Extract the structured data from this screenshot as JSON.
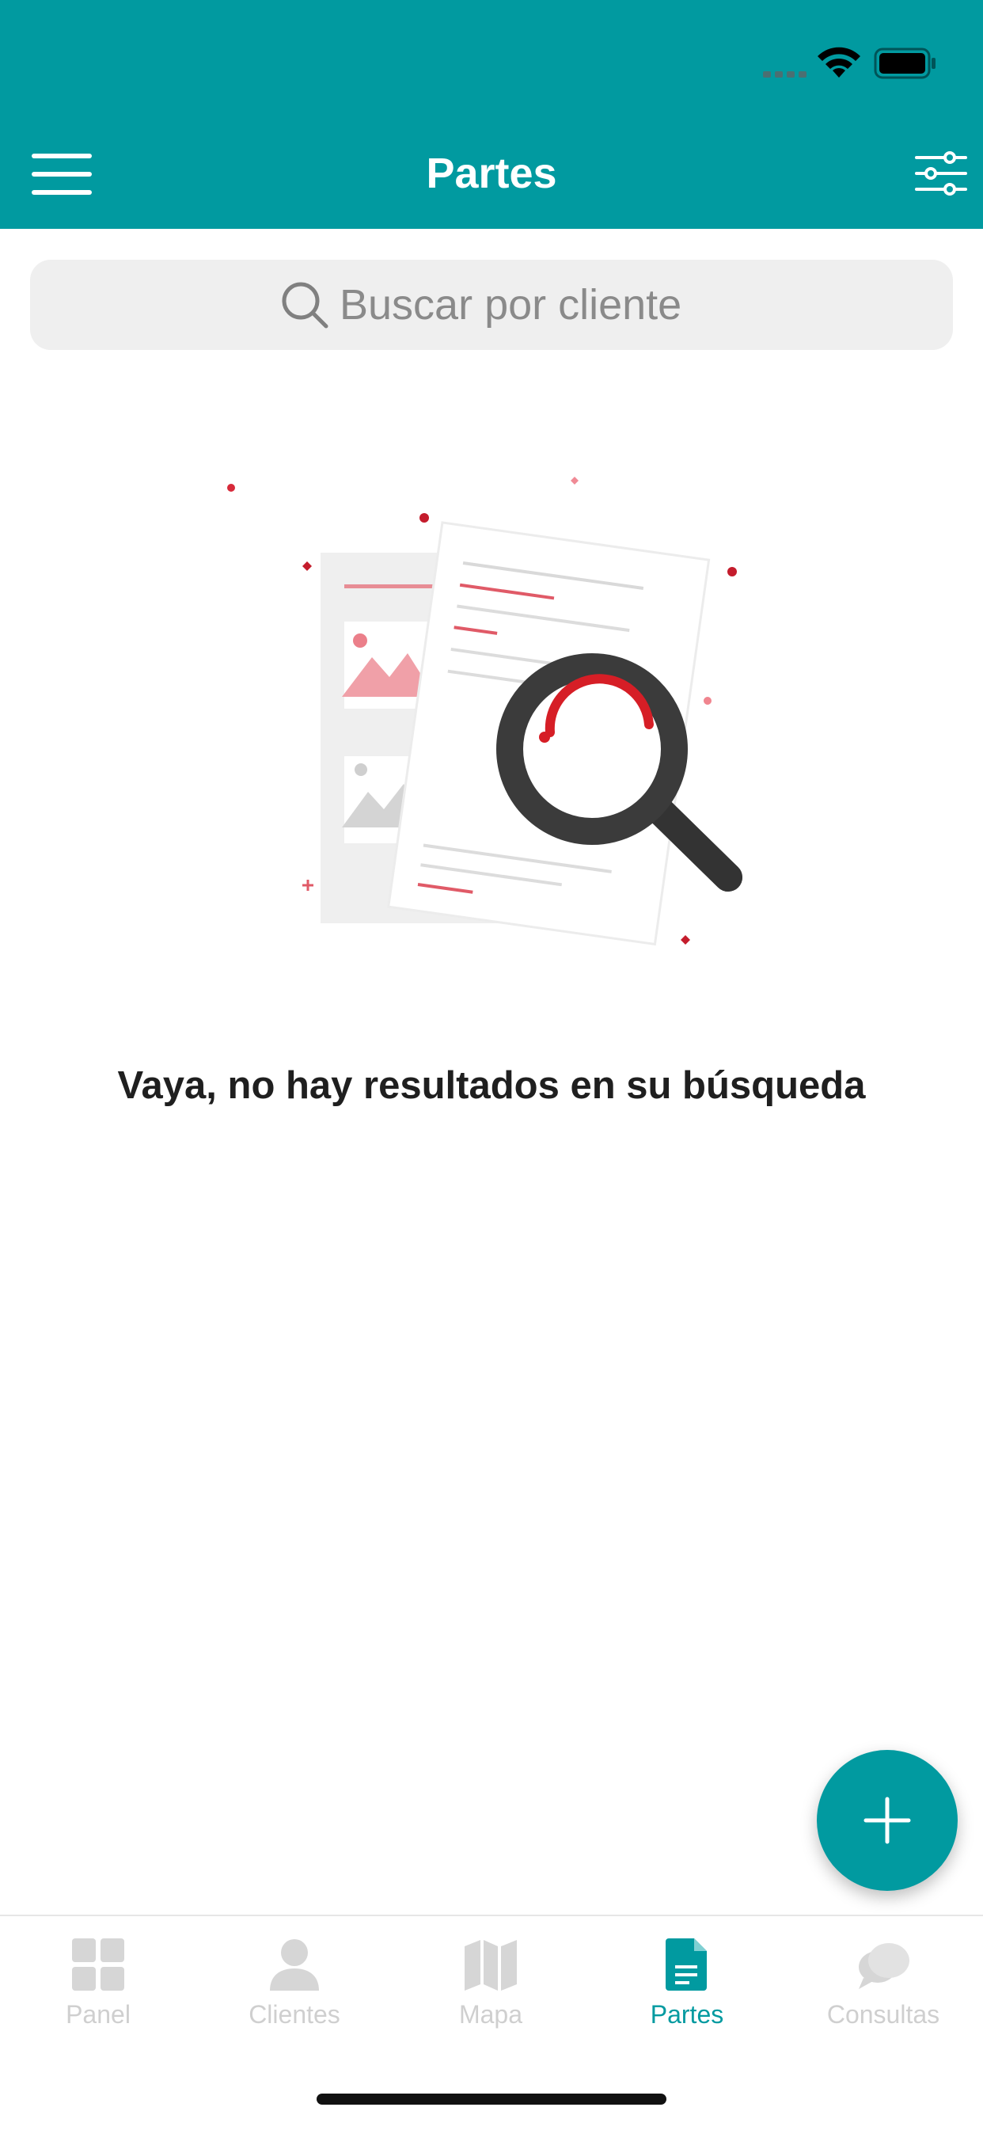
{
  "header": {
    "title": "Partes",
    "menu_icon": "hamburger-menu-icon",
    "filter_icon": "sliders-filter-icon",
    "background": "#019aa0"
  },
  "status_bar": {
    "icons": [
      "signal-icon",
      "wifi-icon",
      "battery-icon"
    ]
  },
  "search": {
    "placeholder": "Buscar por cliente",
    "value": "",
    "icon": "search-icon"
  },
  "empty_state": {
    "illustration": "document-magnifier-illustration",
    "message": "Vaya, no hay resultados en su búsqueda"
  },
  "fab": {
    "icon": "plus-icon",
    "color": "#019aa0"
  },
  "tab_bar": {
    "tabs": [
      {
        "label": "Panel",
        "icon": "grid-icon",
        "active": false
      },
      {
        "label": "Clientes",
        "icon": "person-icon",
        "active": false
      },
      {
        "label": "Mapa",
        "icon": "map-icon",
        "active": false
      },
      {
        "label": "Partes",
        "icon": "document-icon",
        "active": true
      },
      {
        "label": "Consultas",
        "icon": "chat-bubbles-icon",
        "active": false
      }
    ],
    "active_color": "#019aa0",
    "inactive_color": "#cfcfcf"
  }
}
